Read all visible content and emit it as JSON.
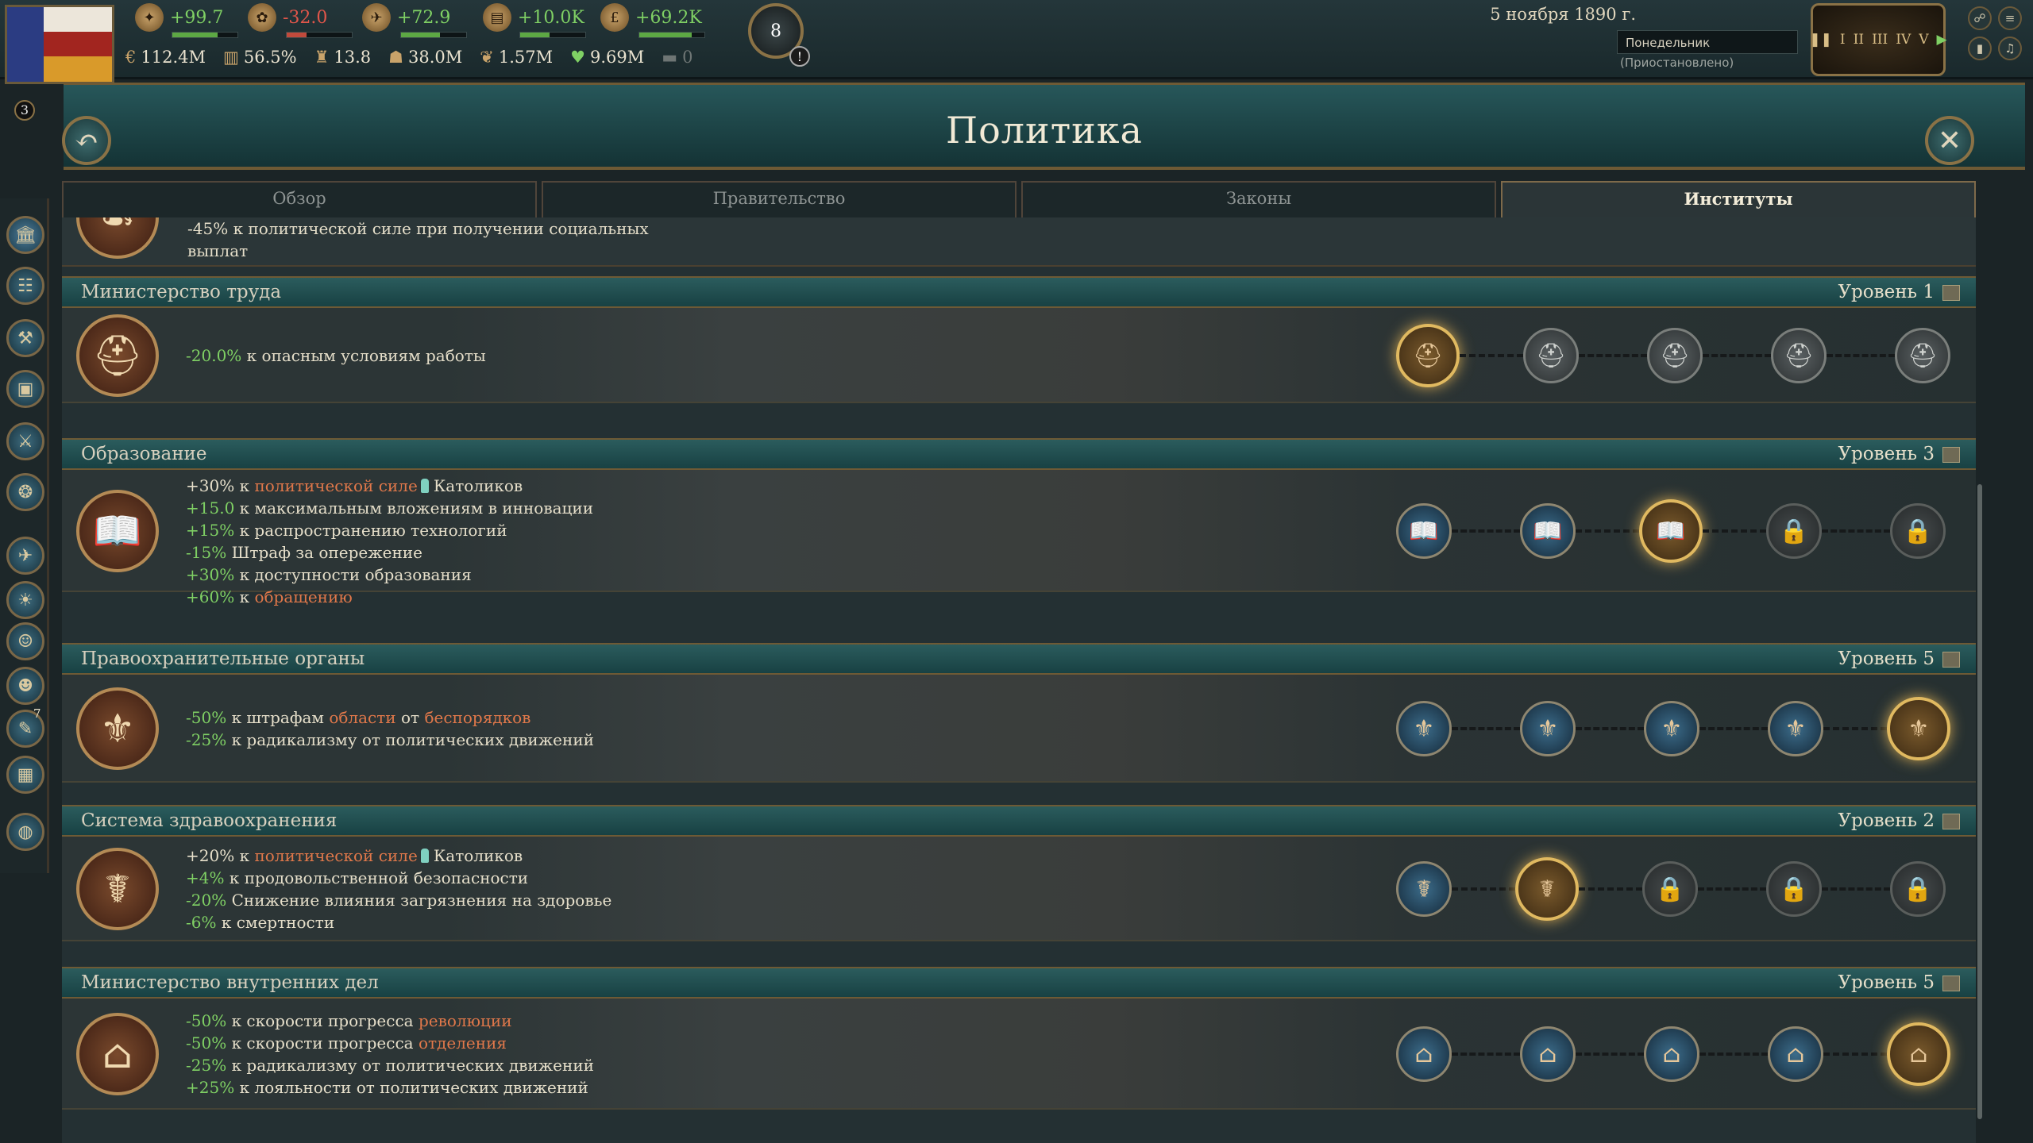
{
  "topbar": {
    "resources": [
      {
        "icon": "authority-icon",
        "value": "+99.7",
        "tone": "pos"
      },
      {
        "icon": "bureaucracy-icon",
        "value": "-32.0",
        "tone": "neg"
      },
      {
        "icon": "influence-icon",
        "value": "+72.9",
        "tone": "pos"
      },
      {
        "icon": "treasury-icon",
        "value": "+10.0K",
        "tone": "pos"
      },
      {
        "icon": "pound-icon",
        "value": "+69.2K",
        "tone": "pos"
      }
    ],
    "stats": [
      {
        "icon": "gdp-icon",
        "value": "112.4M"
      },
      {
        "icon": "literacy-icon",
        "value": "56.5%"
      },
      {
        "icon": "standard-of-living-icon",
        "value": "13.8"
      },
      {
        "icon": "population-icon",
        "value": "38.0M"
      },
      {
        "icon": "incorporated-population-icon",
        "value": "1.57M"
      },
      {
        "icon": "loyalists-icon",
        "value": "9.69M"
      },
      {
        "icon": "radicals-icon",
        "value": "0"
      }
    ],
    "alert_count": "8",
    "alert_mark": "!",
    "date": "5 ноября 1890 г.",
    "weekday": "Понедельник",
    "status": "(Приостановлено)",
    "speed_roman": [
      "I",
      "II",
      "III",
      "IV",
      "V"
    ],
    "left_badge": "3"
  },
  "header": {
    "title": "Политика"
  },
  "tabs": [
    {
      "label": "Обзор"
    },
    {
      "label": "Правительство"
    },
    {
      "label": "Законы"
    },
    {
      "label": "Институты",
      "active": true
    }
  ],
  "sidebar": {
    "badge": "7"
  },
  "partial_top": {
    "text": "-45% к политической силе при получении социальных выплат"
  },
  "institutions": [
    {
      "name": "Министерство труда",
      "level": "Уровень 1",
      "icon": "helmet-icon",
      "effects": [
        [
          {
            "t": "-20.0%",
            "c": "g"
          },
          {
            "t": " к опасным условиям работы"
          }
        ]
      ],
      "levels": [
        "cur",
        "gray",
        "gray",
        "gray",
        "gray"
      ]
    },
    {
      "name": "Образование",
      "level": "Уровень 3",
      "icon": "book-icon",
      "effects": [
        [
          {
            "t": "+30%"
          },
          {
            "t": " к "
          },
          {
            "t": "политической силе",
            "c": "o"
          },
          {
            "pop": true
          },
          {
            "t": "Католиков"
          }
        ],
        [
          {
            "t": "+15.0",
            "c": "g"
          },
          {
            "t": " к максимальным вложениям в инновации"
          }
        ],
        [
          {
            "t": "+15%",
            "c": "g"
          },
          {
            "t": " к распространению технологий"
          }
        ],
        [
          {
            "t": "-15%",
            "c": "g"
          },
          {
            "t": " Штраф за опережение"
          }
        ],
        [
          {
            "t": "+30%",
            "c": "g"
          },
          {
            "t": " к доступности образования"
          }
        ],
        [
          {
            "t": "+60%",
            "c": "g"
          },
          {
            "t": " к "
          },
          {
            "t": "обращению",
            "c": "o"
          }
        ]
      ],
      "levels": [
        "on",
        "on",
        "cur",
        "lock",
        "lock"
      ]
    },
    {
      "name": "Правоохранительные органы",
      "level": "Уровень 5",
      "icon": "police-cap-icon",
      "effects": [
        [
          {
            "t": "-50%",
            "c": "g"
          },
          {
            "t": " к штрафам "
          },
          {
            "t": "области",
            "c": "o"
          },
          {
            "t": " от "
          },
          {
            "t": "беспорядков",
            "c": "o"
          }
        ],
        [
          {
            "t": "-25%",
            "c": "g"
          },
          {
            "t": " к радикализму от политических движений"
          }
        ]
      ],
      "levels": [
        "on",
        "on",
        "on",
        "on",
        "cur"
      ]
    },
    {
      "name": "Система здравоохранения",
      "level": "Уровень 2",
      "icon": "caduceus-icon",
      "effects": [
        [
          {
            "t": "+20%"
          },
          {
            "t": " к "
          },
          {
            "t": "политической силе",
            "c": "o"
          },
          {
            "pop": true
          },
          {
            "t": "Католиков"
          }
        ],
        [
          {
            "t": "+4%",
            "c": "g"
          },
          {
            "t": " к продовольственной безопасности"
          }
        ],
        [
          {
            "t": "-20%",
            "c": "g"
          },
          {
            "t": " Снижение влияния загрязнения на здоровье"
          }
        ],
        [
          {
            "t": "-6%",
            "c": "g"
          },
          {
            "t": " к смертности"
          }
        ]
      ],
      "levels": [
        "on",
        "cur",
        "lock",
        "lock",
        "lock"
      ]
    },
    {
      "name": "Министерство внутренних дел",
      "level": "Уровень 5",
      "icon": "house-icon",
      "effects": [
        [
          {
            "t": "-50%",
            "c": "g"
          },
          {
            "t": " к скорости прогресса "
          },
          {
            "t": "революции",
            "c": "o"
          }
        ],
        [
          {
            "t": "-50%",
            "c": "g"
          },
          {
            "t": " к скорости прогресса "
          },
          {
            "t": "отделения",
            "c": "o"
          }
        ],
        [
          {
            "t": "-25%",
            "c": "g"
          },
          {
            "t": " к радикализму от политических движений"
          }
        ],
        [
          {
            "t": "+25%",
            "c": "g"
          },
          {
            "t": " к лояльности от политических движений"
          }
        ]
      ],
      "levels": [
        "on",
        "on",
        "on",
        "on",
        "cur"
      ]
    }
  ]
}
